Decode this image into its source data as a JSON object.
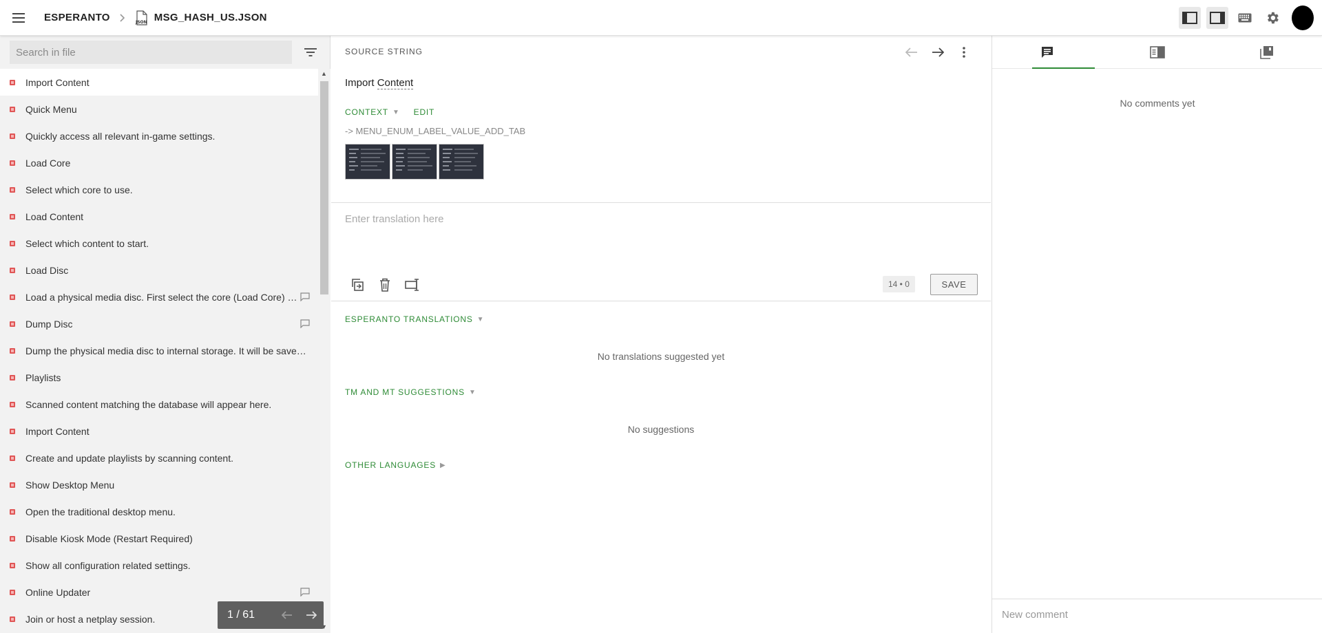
{
  "header": {
    "project": "ESPERANTO",
    "file_name": "MSG_HASH_US.JSON",
    "file_icon_label": "JSON"
  },
  "sidebar": {
    "search_placeholder": "Search in file",
    "items": [
      {
        "label": "Import Content",
        "selected": true,
        "comment": false
      },
      {
        "label": "Quick Menu",
        "comment": false
      },
      {
        "label": "Quickly access all relevant in-game settings.",
        "comment": false
      },
      {
        "label": "Load Core",
        "comment": false
      },
      {
        "label": "Select which core to use.",
        "comment": false
      },
      {
        "label": "Load Content",
        "comment": false
      },
      {
        "label": "Select which content to start.",
        "comment": false
      },
      {
        "label": "Load Disc",
        "comment": false
      },
      {
        "label": "Load a physical media disc. First select the core (Load Core) …",
        "comment": true
      },
      {
        "label": "Dump Disc",
        "comment": true
      },
      {
        "label": "Dump the physical media disc to internal storage. It will be saved…",
        "comment": false
      },
      {
        "label": "Playlists",
        "comment": false
      },
      {
        "label": "Scanned content matching the database will appear here.",
        "comment": false
      },
      {
        "label": "Import Content",
        "comment": false
      },
      {
        "label": "Create and update playlists by scanning content.",
        "comment": false
      },
      {
        "label": "Show Desktop Menu",
        "comment": false
      },
      {
        "label": "Open the traditional desktop menu.",
        "comment": false
      },
      {
        "label": "Disable Kiosk Mode (Restart Required)",
        "comment": false
      },
      {
        "label": "Show all configuration related settings.",
        "comment": false
      },
      {
        "label": "Online Updater",
        "comment": true
      },
      {
        "label": "Join or host a netplay session.",
        "comment": false
      }
    ],
    "pager": "1 / 61"
  },
  "source": {
    "section_title": "SOURCE STRING",
    "text_part1": "Import ",
    "text_part2": "Content",
    "context_label": "CONTEXT",
    "edit_label": "EDIT",
    "context_key": "-> MENU_ENUM_LABEL_VALUE_ADD_TAB"
  },
  "editor": {
    "placeholder": "Enter translation here",
    "counter": "14 • 0",
    "save_label": "SAVE"
  },
  "suggestions": {
    "translations_title": "ESPERANTO TRANSLATIONS",
    "translations_empty": "No translations suggested yet",
    "tm_title": "TM AND MT SUGGESTIONS",
    "tm_empty": "No suggestions",
    "other_title": "OTHER LANGUAGES"
  },
  "comments": {
    "empty": "No comments yet",
    "placeholder": "New comment"
  },
  "colors": {
    "accent_green": "#2e8b36",
    "status_red": "#e05555",
    "progress_blue": "#4a90d9"
  }
}
